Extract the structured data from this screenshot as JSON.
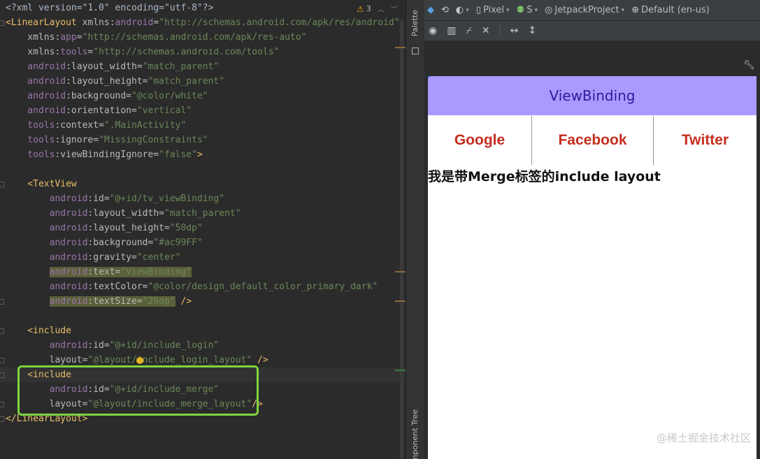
{
  "editor": {
    "warnings": {
      "icon": "warning-icon",
      "count": "3"
    },
    "lines": [
      [
        [
          "t-plain",
          "<?xml version=\"1.0\" encoding=\"utf-8\"?>"
        ]
      ],
      [
        [
          "t-tag",
          "<LinearLayout "
        ],
        [
          "t-attr",
          "xmlns:"
        ],
        [
          "t-ns",
          "android"
        ],
        [
          "t-attr",
          "="
        ],
        [
          "t-val",
          "\"http://schemas.android.com/apk/res/android\""
        ]
      ],
      [
        [
          "t-attr",
          "    xmlns:"
        ],
        [
          "t-ns",
          "app"
        ],
        [
          "t-attr",
          "="
        ],
        [
          "t-val",
          "\"http://schemas.android.com/apk/res-auto\""
        ]
      ],
      [
        [
          "t-attr",
          "    xmlns:"
        ],
        [
          "t-ns",
          "tools"
        ],
        [
          "t-attr",
          "="
        ],
        [
          "t-val",
          "\"http://schemas.android.com/tools\""
        ]
      ],
      [
        [
          "t-ns",
          "    android"
        ],
        [
          "t-attr",
          ":layout_width="
        ],
        [
          "t-val",
          "\"match_parent\""
        ]
      ],
      [
        [
          "t-ns",
          "    android"
        ],
        [
          "t-attr",
          ":layout_height="
        ],
        [
          "t-val",
          "\"match_parent\""
        ]
      ],
      [
        [
          "t-ns",
          "    android"
        ],
        [
          "t-attr",
          ":background="
        ],
        [
          "t-val",
          "\"@color/white\""
        ]
      ],
      [
        [
          "t-ns",
          "    android"
        ],
        [
          "t-attr",
          ":orientation="
        ],
        [
          "t-val",
          "\"vertical\""
        ]
      ],
      [
        [
          "t-ns",
          "    tools"
        ],
        [
          "t-attr",
          ":context="
        ],
        [
          "t-val",
          "\".MainActivity\""
        ]
      ],
      [
        [
          "t-ns",
          "    tools"
        ],
        [
          "t-attr",
          ":ignore="
        ],
        [
          "t-val",
          "\"MissingConstraints\""
        ]
      ],
      [
        [
          "t-ns",
          "    tools"
        ],
        [
          "t-attr",
          ":viewBindingIgnore="
        ],
        [
          "t-val",
          "\"false\""
        ],
        [
          "t-tag",
          ">"
        ]
      ],
      [
        [
          "t-plain",
          ""
        ]
      ],
      [
        [
          "t-tag",
          "    <TextView"
        ]
      ],
      [
        [
          "t-ns",
          "        android"
        ],
        [
          "t-attr",
          ":id="
        ],
        [
          "t-val",
          "\"@+id/tv_viewBinding\""
        ]
      ],
      [
        [
          "t-ns",
          "        android"
        ],
        [
          "t-attr",
          ":layout_width="
        ],
        [
          "t-val",
          "\"match_parent\""
        ]
      ],
      [
        [
          "t-ns",
          "        android"
        ],
        [
          "t-attr",
          ":layout_height="
        ],
        [
          "t-val",
          "\"50dp\""
        ]
      ],
      [
        [
          "t-ns",
          "        android"
        ],
        [
          "t-attr",
          ":background="
        ],
        [
          "t-val",
          "\"#ac99FF\""
        ]
      ],
      [
        [
          "t-ns",
          "        android"
        ],
        [
          "t-attr",
          ":gravity="
        ],
        [
          "t-val",
          "\"center\""
        ]
      ],
      [
        [
          "t-plain",
          "        "
        ],
        [
          "t-ns hl-bright",
          "android"
        ],
        [
          "t-attr hl-bright",
          ":text="
        ],
        [
          "t-val hl-bright",
          "\"ViewBinding\""
        ]
      ],
      [
        [
          "t-ns",
          "        android"
        ],
        [
          "t-attr",
          ":textColor="
        ],
        [
          "t-val",
          "\"@color/design_default_color_primary_dark\""
        ]
      ],
      [
        [
          "t-plain",
          "        "
        ],
        [
          "t-ns hl-bright",
          "android"
        ],
        [
          "t-attr hl-bright",
          ":textSize="
        ],
        [
          "t-val hl-bright",
          "\"20dp\""
        ],
        [
          "t-tag",
          " />"
        ]
      ],
      [
        [
          "t-plain",
          ""
        ]
      ],
      [
        [
          "t-tag",
          "    <include"
        ]
      ],
      [
        [
          "t-ns",
          "        android"
        ],
        [
          "t-attr",
          ":id="
        ],
        [
          "t-val",
          "\"@+id/include_login\""
        ]
      ],
      [
        [
          "t-attr",
          "        layout="
        ],
        [
          "t-val",
          "\"@layout/include_login_layout\""
        ],
        [
          "t-tag",
          " />"
        ]
      ],
      [
        [
          "t-tag",
          "    <include"
        ]
      ],
      [
        [
          "t-ns",
          "        android"
        ],
        [
          "t-attr",
          ":id="
        ],
        [
          "t-val",
          "\"@+id/include_merge\""
        ]
      ],
      [
        [
          "t-attr",
          "        layout="
        ],
        [
          "t-val",
          "\"@layout/include_merge_layout\""
        ],
        [
          "t-tag",
          "/>"
        ]
      ],
      [
        [
          "t-tag",
          "</LinearLayout>"
        ]
      ]
    ]
  },
  "tool_strip": {
    "palette_tab": "Palette",
    "component_tree_tab": "Component Tree"
  },
  "design_toolbar": {
    "device": "Pixel",
    "api": "S",
    "theme": "JetpackProject",
    "locale": "Default (en-us)"
  },
  "preview": {
    "header_text": "ViewBinding",
    "header_bg": "#ac99ff",
    "header_text_color": "#2b1d9f",
    "login_buttons": [
      "Google",
      "Facebook",
      "Twitter"
    ],
    "button_color": "#c62d1d",
    "merge_text": "我是带Merge标签的include layout"
  },
  "watermark": "@稀土掘金技术社区"
}
